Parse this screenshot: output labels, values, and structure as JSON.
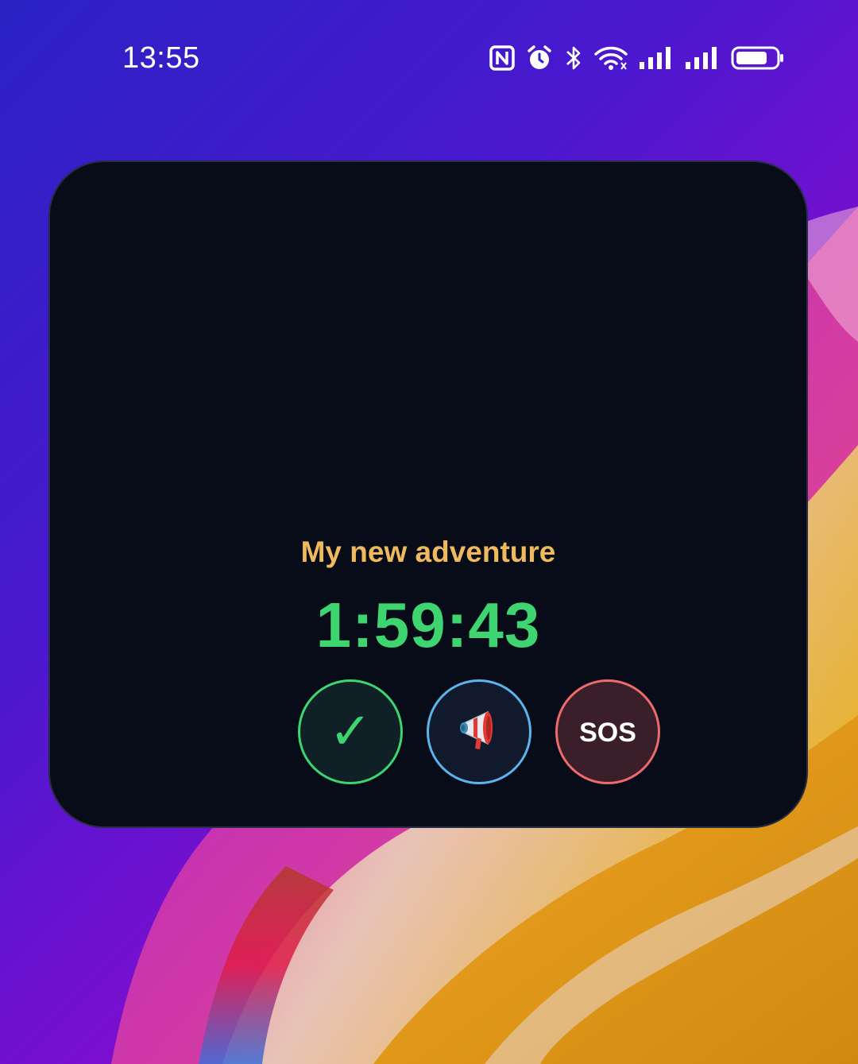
{
  "status_bar": {
    "time": "13:55",
    "icons": [
      "nfc-icon",
      "alarm-icon",
      "bluetooth-icon",
      "wifi-icon",
      "signal-icon",
      "signal-icon",
      "battery-icon"
    ]
  },
  "widget": {
    "title": "My new adventure",
    "timer": "1:59:43",
    "actions": [
      {
        "name": "check-in-button",
        "icon": "checkmark-icon",
        "glyph": "✓"
      },
      {
        "name": "announce-button",
        "icon": "megaphone-icon"
      },
      {
        "name": "sos-button",
        "label": "SOS"
      }
    ]
  },
  "colors": {
    "title": "#f1b95d",
    "timer": "#3ed571",
    "check_accent": "#3ed571",
    "announce_accent": "#5cb4ec",
    "sos_accent": "#ee6b6b",
    "card_background": "#080c19"
  }
}
